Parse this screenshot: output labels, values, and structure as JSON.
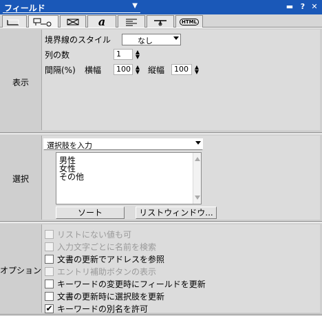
{
  "window": {
    "title": "フィールド",
    "minimize_glyph": "▬",
    "help_glyph": "?",
    "close_glyph": "✕"
  },
  "tabs": [
    {
      "name": "tab-field-type",
      "icon": "field-box-icon",
      "active": false
    },
    {
      "name": "tab-field-settings",
      "icon": "field-settings-icon",
      "active": true
    },
    {
      "name": "tab-graphics",
      "icon": "graphics-icon",
      "active": false
    },
    {
      "name": "tab-text-style",
      "icon": "font-italic-icon",
      "label": "a",
      "active": false
    },
    {
      "name": "tab-paragraph",
      "icon": "paragraph-align-icon",
      "active": false
    },
    {
      "name": "tab-position",
      "icon": "position-icon",
      "active": false
    },
    {
      "name": "tab-html",
      "icon": "html-icon",
      "label": "HTML",
      "active": false
    }
  ],
  "display": {
    "section_label": "表示",
    "border_style_label": "境界線のスタイル",
    "border_style_value": "なし",
    "columns_label": "列の数",
    "columns_value": "1",
    "spacing_label": "間隔(%)",
    "horizontal_label": "横幅",
    "horizontal_value": "100",
    "vertical_label": "縦幅",
    "vertical_value": "100"
  },
  "selection": {
    "section_label": "選択",
    "mode_value": "選択肢を入力",
    "choices": [
      "男性",
      "女性",
      "その他"
    ],
    "sort_button": "ソート",
    "list_window_button": "リストウィンドウ..."
  },
  "options": {
    "section_label": "オプション",
    "items": [
      {
        "label": "リストにない値も可",
        "checked": false,
        "enabled": false
      },
      {
        "label": "入力文字ごとに名前を検索",
        "checked": false,
        "enabled": false
      },
      {
        "label": "文書の更新でアドレスを参照",
        "checked": false,
        "enabled": true
      },
      {
        "label": "エントリ補助ボタンの表示",
        "checked": false,
        "enabled": false
      },
      {
        "label": "キーワードの変更時にフィールドを更新",
        "checked": false,
        "enabled": true
      },
      {
        "label": "文書の更新時に選択肢を更新",
        "checked": false,
        "enabled": true
      },
      {
        "label": "キーワードの別名を許可",
        "checked": true,
        "enabled": true
      }
    ],
    "checkmark_glyph": "✔"
  }
}
